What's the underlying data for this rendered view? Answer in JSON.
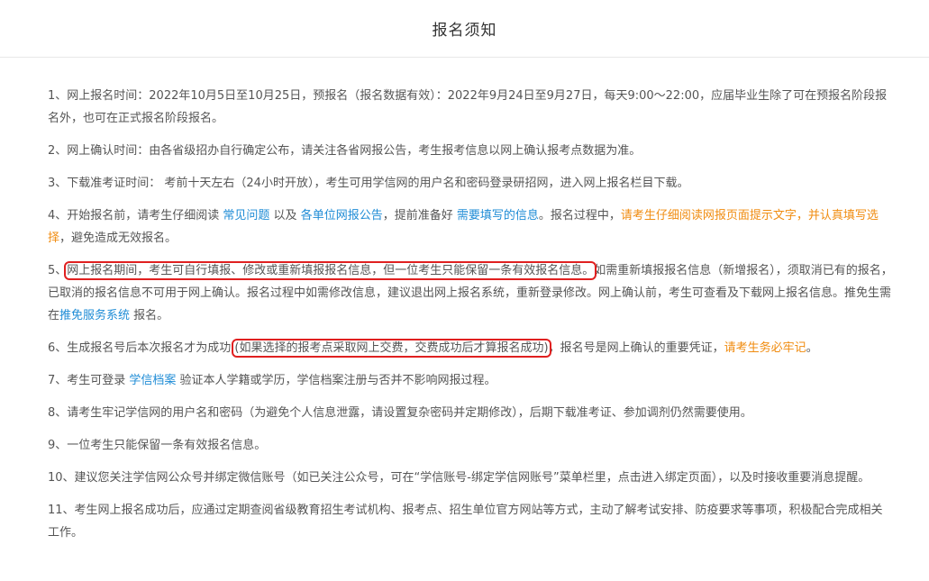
{
  "header": {
    "title": "报名须知"
  },
  "items": [
    {
      "text": "1、网上报名时间：2022年10月5日至10月25日，预报名（报名数据有效）：2022年9月24日至9月27日，每天9:00～22:00，应届毕业生除了可在预报名阶段报名外，也可在正式报名阶段报名。"
    },
    {
      "text": "2、网上确认时间：由各省级招办自行确定公布，请关注各省网报公告，考生报考信息以网上确认报考点数据为准。"
    },
    {
      "text": "3、下载准考证时间： 考前十天左右（24小时开放），考生可用学信网的用户名和密码登录研招网，进入网上报名栏目下载。"
    },
    {
      "p1": "4、开始报名前，请考生仔细阅读 ",
      "link1": "常见问题",
      "p2": " 以及 ",
      "link2": "各单位网报公告",
      "p3": "，提前准备好 ",
      "link3": "需要填写的信息",
      "p4": "。报名过程中，",
      "warn": "请考生仔细阅读网报页面提示文字，并认真填写选择",
      "p5": "，避免造成无效报名。"
    },
    {
      "p1": "5、",
      "boxed": "网上报名期间，考生可自行填报、修改或重新填报报名信息，但一位考生只能保留一条有效报名信息。",
      "p2": "如需重新填报报名信息（新增报名），须取消已有的报名，已取消的报名信息不可用于网上确认。报名过程中如需修改信息，建议退出网上报名系统，重新登录修改。网上确认前，考生可查看及下载网上报名信息。推免生需在",
      "link": "推免服务系统",
      "p3": " 报名。"
    },
    {
      "p1": "6、生成报名号后本次报名才为成功 ",
      "boxed": "(如果选择的报考点采取网上交费，交费成功后才算报名成功)",
      "p2": "，报名号是网上确认的重要凭证，",
      "warn": "请考生务必牢记",
      "p3": "。"
    },
    {
      "p1": "7、考生可登录 ",
      "link": "学信档案",
      "p2": " 验证本人学籍或学历，学信档案注册与否并不影响网报过程。"
    },
    {
      "text": "8、请考生牢记学信网的用户名和密码（为避免个人信息泄露，请设置复杂密码并定期修改），后期下载准考证、参加调剂仍然需要使用。"
    },
    {
      "text": "9、一位考生只能保留一条有效报名信息。"
    },
    {
      "text": "10、建议您关注学信网公众号并绑定微信账号（如已关注公众号，可在“学信账号-绑定学信网账号”菜单栏里，点击进入绑定页面），以及时接收重要消息提醒。"
    },
    {
      "text": "11、考生网上报名成功后，应通过定期查阅省级教育招生考试机构、报考点、招生单位官方网站等方式，主动了解考试安排、防疫要求等事项，积极配合完成相关工作。"
    }
  ]
}
